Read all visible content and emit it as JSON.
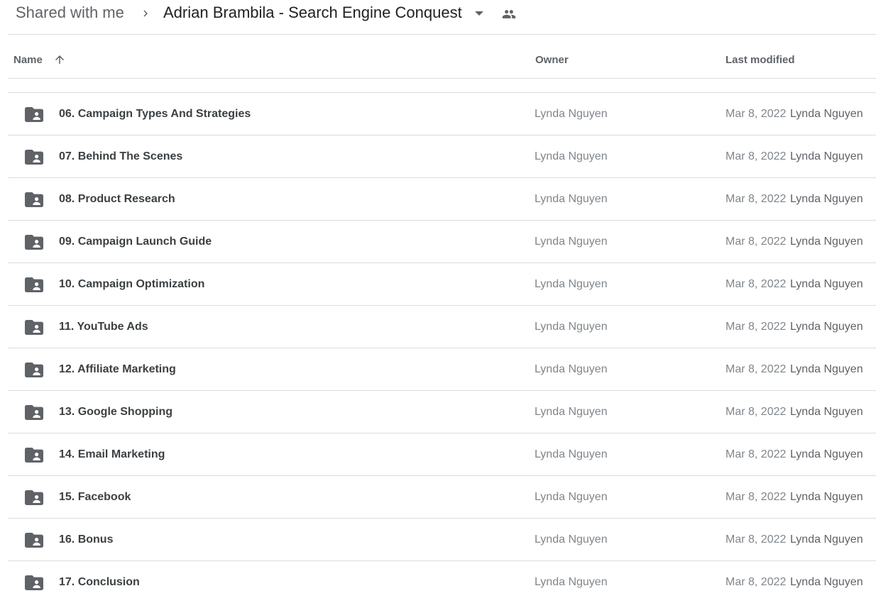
{
  "breadcrumb": {
    "root": "Shared with me",
    "current": "Adrian Brambila - Search Engine Conquest",
    "icons": {
      "separator": "chevron-right-icon",
      "dropdown": "caret-down-icon",
      "shared": "people-icon"
    }
  },
  "columns": {
    "name": "Name",
    "owner": "Owner",
    "last_modified": "Last modified",
    "sort_icon": "arrow-up-icon"
  },
  "colors": {
    "folder_icon": "#5f6368",
    "divider": "#dadce0"
  },
  "rows": [
    {
      "name": "06. Campaign Types And Strategies",
      "owner": "Lynda Nguyen",
      "modified_date": "Mar 8, 2022",
      "modified_by": "Lynda Nguyen"
    },
    {
      "name": "07. Behind The Scenes",
      "owner": "Lynda Nguyen",
      "modified_date": "Mar 8, 2022",
      "modified_by": "Lynda Nguyen"
    },
    {
      "name": "08. Product Research",
      "owner": "Lynda Nguyen",
      "modified_date": "Mar 8, 2022",
      "modified_by": "Lynda Nguyen"
    },
    {
      "name": "09. Campaign Launch Guide",
      "owner": "Lynda Nguyen",
      "modified_date": "Mar 8, 2022",
      "modified_by": "Lynda Nguyen"
    },
    {
      "name": "10. Campaign Optimization",
      "owner": "Lynda Nguyen",
      "modified_date": "Mar 8, 2022",
      "modified_by": "Lynda Nguyen"
    },
    {
      "name": "11. YouTube Ads",
      "owner": "Lynda Nguyen",
      "modified_date": "Mar 8, 2022",
      "modified_by": "Lynda Nguyen"
    },
    {
      "name": "12. Affiliate Marketing",
      "owner": "Lynda Nguyen",
      "modified_date": "Mar 8, 2022",
      "modified_by": "Lynda Nguyen"
    },
    {
      "name": "13. Google Shopping",
      "owner": "Lynda Nguyen",
      "modified_date": "Mar 8, 2022",
      "modified_by": "Lynda Nguyen"
    },
    {
      "name": "14. Email Marketing",
      "owner": "Lynda Nguyen",
      "modified_date": "Mar 8, 2022",
      "modified_by": "Lynda Nguyen"
    },
    {
      "name": "15. Facebook",
      "owner": "Lynda Nguyen",
      "modified_date": "Mar 8, 2022",
      "modified_by": "Lynda Nguyen"
    },
    {
      "name": "16. Bonus",
      "owner": "Lynda Nguyen",
      "modified_date": "Mar 8, 2022",
      "modified_by": "Lynda Nguyen"
    },
    {
      "name": "17. Conclusion",
      "owner": "Lynda Nguyen",
      "modified_date": "Mar 8, 2022",
      "modified_by": "Lynda Nguyen"
    }
  ]
}
